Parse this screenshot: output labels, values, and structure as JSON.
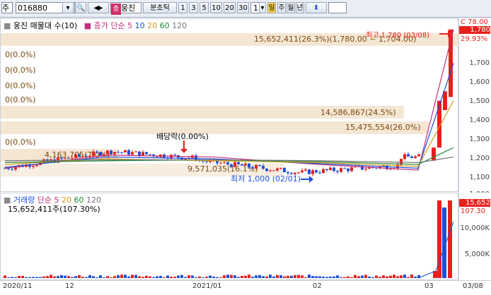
{
  "toolbar": {
    "market": "주",
    "code": "016880",
    "name_tag": "웅진",
    "tick_label": "분초틱",
    "intervals": [
      "1",
      "3",
      "5",
      "10",
      "20",
      "30"
    ],
    "interval_value": "1",
    "day": "일",
    "week": "주",
    "month": "월",
    "year": "년"
  },
  "price_panel": {
    "legend_stock": "웅진 매물대 수(10)",
    "legend_ma": "종가 단순",
    "ma_periods": [
      "5",
      "10",
      "20",
      "60",
      "120"
    ],
    "high_note": "최고 1,780 (03/08)",
    "low_note": "최저 1,000 (02/01)",
    "div_note": "배당락(0.00%)",
    "volume_profile": [
      "15,652,411(26.3%)(1,780.00 ~ 1,704.00)",
      "0(0.0%)",
      "0(0.0%)",
      "0(0.0%)",
      "0(0.0%)",
      "14,586,867(24.5%)",
      "15,475,554(26.0%)",
      "0(0.0%)",
      "4,163,705(7.0%)",
      "9,571,035(16.1%)"
    ],
    "y_ticks": [
      "1,700",
      "1,600",
      "1,500",
      "1,400",
      "1,300",
      "1,200",
      "1,100",
      "1,000"
    ],
    "current_price": "1,780",
    "current_change": "29.93%",
    "c_label": "C 78.00"
  },
  "volume_panel": {
    "legend_label": "거래량",
    "legend_ma": "단순",
    "ma_periods": [
      "5",
      "20",
      "60",
      "120"
    ],
    "summary": "15,652,411주(107.30%)",
    "y_ticks": [
      "10,000K",
      "5,000K"
    ],
    "current_volume": "15,652",
    "current_pct": "107.30"
  },
  "x_axis": [
    "2020/11",
    "12",
    "2021/01",
    "02",
    "03",
    "03/08"
  ],
  "colors": {
    "up": "#e8201c",
    "down": "#1d4fd8",
    "accent": "#f7e0c4"
  },
  "chart_data": {
    "type": "candlestick",
    "x": [
      "2020/11",
      "12",
      "2021/01",
      "02",
      "03"
    ],
    "ylim": [
      960,
      1800
    ],
    "high": 1780,
    "low": 1000,
    "last_close": 1780,
    "series": [
      {
        "name": "5",
        "values": [
          1040,
          1110,
          1100,
          1060,
          1030,
          1780
        ]
      },
      {
        "name": "10",
        "values": [
          1045,
          1100,
          1090,
          1065,
          1040,
          1600
        ]
      },
      {
        "name": "20",
        "values": [
          1060,
          1090,
          1080,
          1070,
          1050,
          1400
        ]
      },
      {
        "name": "60",
        "values": [
          1070,
          1080,
          1085,
          1075,
          1060,
          1150
        ]
      },
      {
        "name": "120",
        "values": [
          1080,
          1085,
          1085,
          1080,
          1070,
          1100
        ]
      }
    ],
    "volume_ylim": [
      0,
      16000
    ],
    "volume_last": 15652
  }
}
